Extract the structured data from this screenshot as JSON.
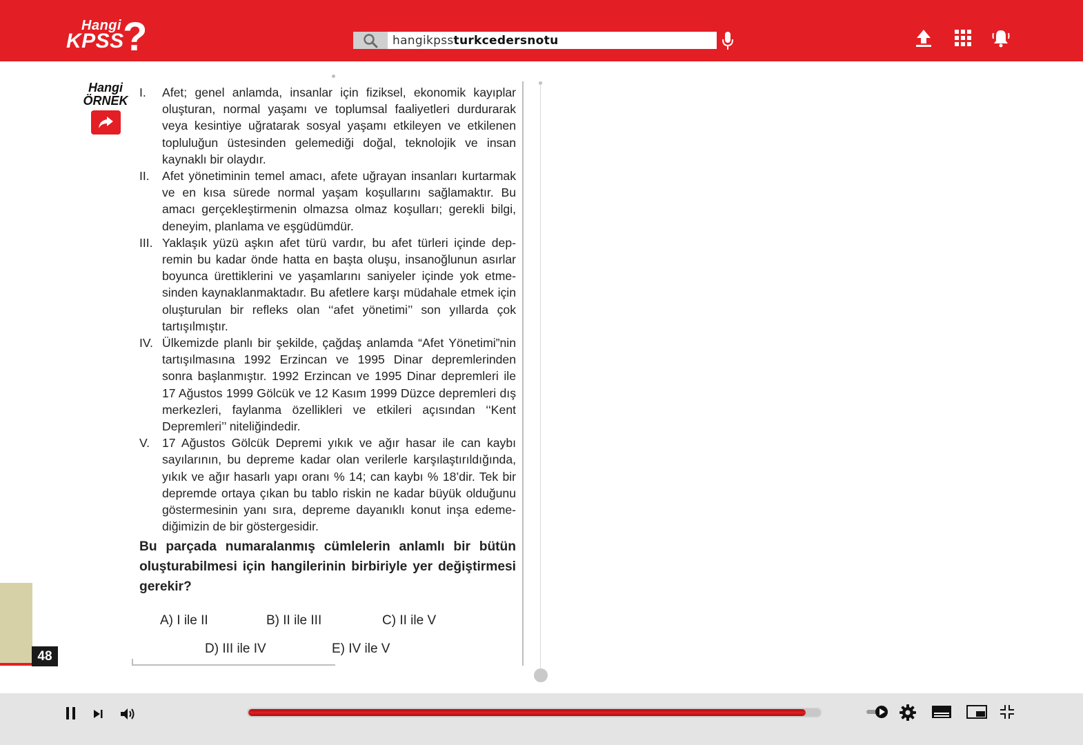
{
  "header": {
    "logo_top": "Hangi",
    "logo_main": "KPSS",
    "logo_mark": "?",
    "search": {
      "text_prefix": "hangikpss",
      "text_bold": "turkcedersnotu"
    },
    "icons": [
      "search-icon",
      "microphone-icon",
      "upload-icon",
      "apps-grid-icon",
      "bell-icon"
    ]
  },
  "badge": {
    "line1": "Hangi",
    "line2": "ÖRNEK",
    "icon": "share-arrow-icon"
  },
  "page_number": "48",
  "items": [
    {
      "num": "I.",
      "text": "Afet; genel anlamda, insanlar için fiziksel, ekonomik kayıplar oluşturan, normal yaşamı ve toplumsal faaliyetleri durdurarak veya kesintiye uğratarak sosyal yaşamı etkileyen ve etkilenen topluluğun üstesinden gelemediği doğal, teknolojik ve insan kaynaklı bir olaydır."
    },
    {
      "num": "II.",
      "text": "Afet yönetiminin temel amacı, afete uğrayan insanları kurtarmak ve en kısa sürede normal yaşam koşullarını sağlamaktır. Bu amacı gerçekleştirmenin olmazsa olmaz koşulları; gerekli bilgi, deneyim, planlama ve eşgüdümdür."
    },
    {
      "num": "III.",
      "text": "Yaklaşık yüzü aşkın afet türü vardır, bu afet türleri içinde dep­remin bu kadar önde hatta en başta oluşu, insanoğlunun asırlar boyunca ürettiklerini ve yaşamlarını saniyeler içinde yok etme­sinden kaynaklanmaktadır. Bu afetlere karşı müdahale etmek için oluşturulan bir refleks olan ‘‘afet yönetimi’’ son yıllarda çok tartışılmıştır."
    },
    {
      "num": "IV.",
      "text": "Ülkemizde planlı bir şekilde, çağdaş anlamda “Afet Yönetimi”­nin tartışılmasına 1992 Erzincan ve 1995 Dinar depremlerinden sonra başlanmıştır. 1992 Erzincan ve 1995 Dinar depremleri ile 17 Ağustos 1999 Gölcük ve 12 Kasım 1999 Düzce depremleri dış merkezleri, faylanma özellikleri ve etkileri açısından ‘‘Kent Depremleri’’ niteliğindedir."
    },
    {
      "num": "V.",
      "text": "17 Ağustos Gölcük Depremi yıkık ve ağır hasar ile can kaybı sayılarının, bu depreme kadar olan verilerle karşılaştırıldığında, yıkık ve ağır hasarlı yapı oranı % 14; can kaybı % 18’dir. Tek bir depremde ortaya çıkan bu tablo riskin ne kadar büyük olduğunu göstermesinin yanı sıra, depreme dayanıklı konut inşa edeme­diğimizin de bir göstergesidir."
    }
  ],
  "question": "Bu parçada numaralanmış cümlelerin anlamlı bir bütün oluşturabilmesi için hangilerinin birbiriyle yer değiştirmesi gerekir?",
  "options": {
    "a": "A) I ile II",
    "b": "B) II ile III",
    "c": "C) II ile V",
    "d": "D) III ile IV",
    "e": "E) IV ile V"
  },
  "player": {
    "progress": 0.975,
    "controls": [
      "pause-icon",
      "next-icon",
      "volume-icon",
      "autoplay-toggle-icon",
      "settings-gear-icon",
      "subtitles-icon",
      "miniplayer-icon",
      "exit-fullscreen-icon"
    ]
  }
}
